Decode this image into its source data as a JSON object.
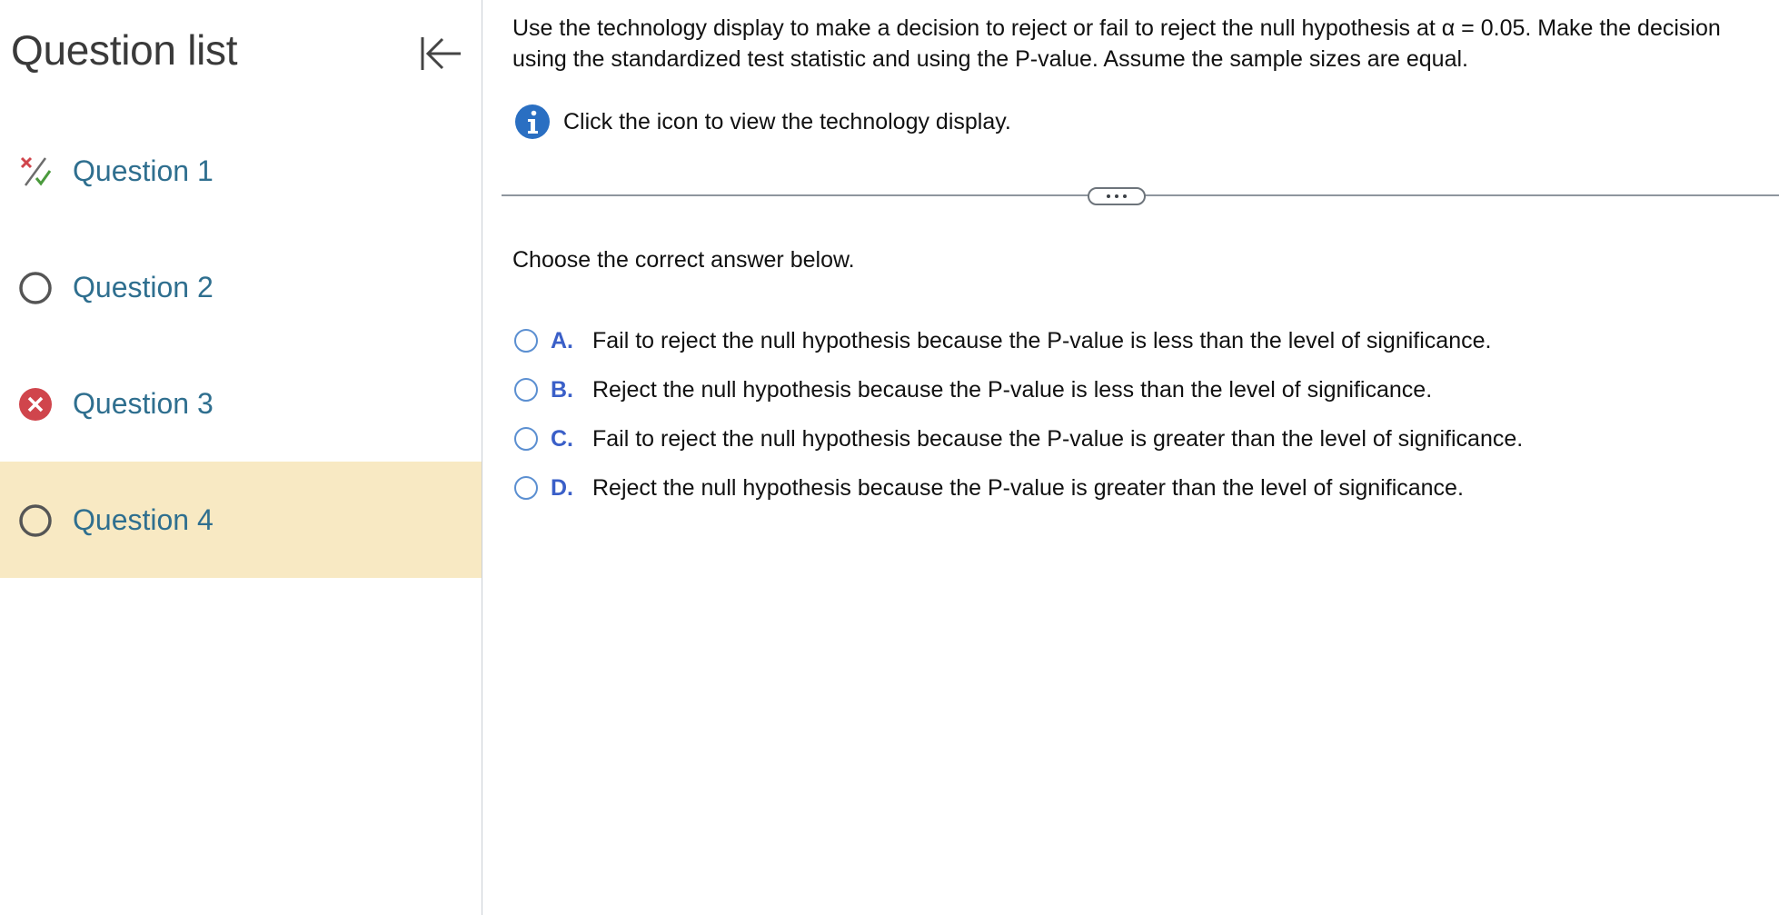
{
  "sidebar": {
    "title": "Question list",
    "items": [
      {
        "label": "Question 1",
        "status": "partial",
        "active": false
      },
      {
        "label": "Question 2",
        "status": "unanswered",
        "active": false
      },
      {
        "label": "Question 3",
        "status": "incorrect",
        "active": false
      },
      {
        "label": "Question 4",
        "status": "unanswered",
        "active": true
      }
    ]
  },
  "question": {
    "prompt": "Use the technology display to make a decision to reject or fail to reject the null hypothesis at α = 0.05. Make the decision using the standardized test statistic and using the P-value. Assume the sample sizes are equal.",
    "info_text": "Click the icon to view the technology display.",
    "choose_text": "Choose the correct answer below.",
    "options": [
      {
        "letter": "A.",
        "text": "Fail to reject the null hypothesis because the P-value is less than the level of significance."
      },
      {
        "letter": "B.",
        "text": "Reject the null hypothesis because the P-value is less than the level of significance."
      },
      {
        "letter": "C.",
        "text": "Fail to reject the null hypothesis because the P-value is greater than the level of significance."
      },
      {
        "letter": "D.",
        "text": "Reject the null hypothesis because the P-value is greater than the level of significance."
      }
    ]
  },
  "colors": {
    "link": "#2f6f8f",
    "active_bg": "#f8e9c3",
    "option_letter": "#3a5fc8",
    "radio_border": "#5b8fd1",
    "incorrect": "#d0454c",
    "correct": "#4a9a3c",
    "info_icon": "#2a6fc2"
  },
  "icons": {
    "collapse": "collapse-left-icon",
    "info": "info-icon",
    "partial": "partial-credit-icon",
    "unanswered": "empty-circle-icon",
    "incorrect": "incorrect-x-icon"
  }
}
